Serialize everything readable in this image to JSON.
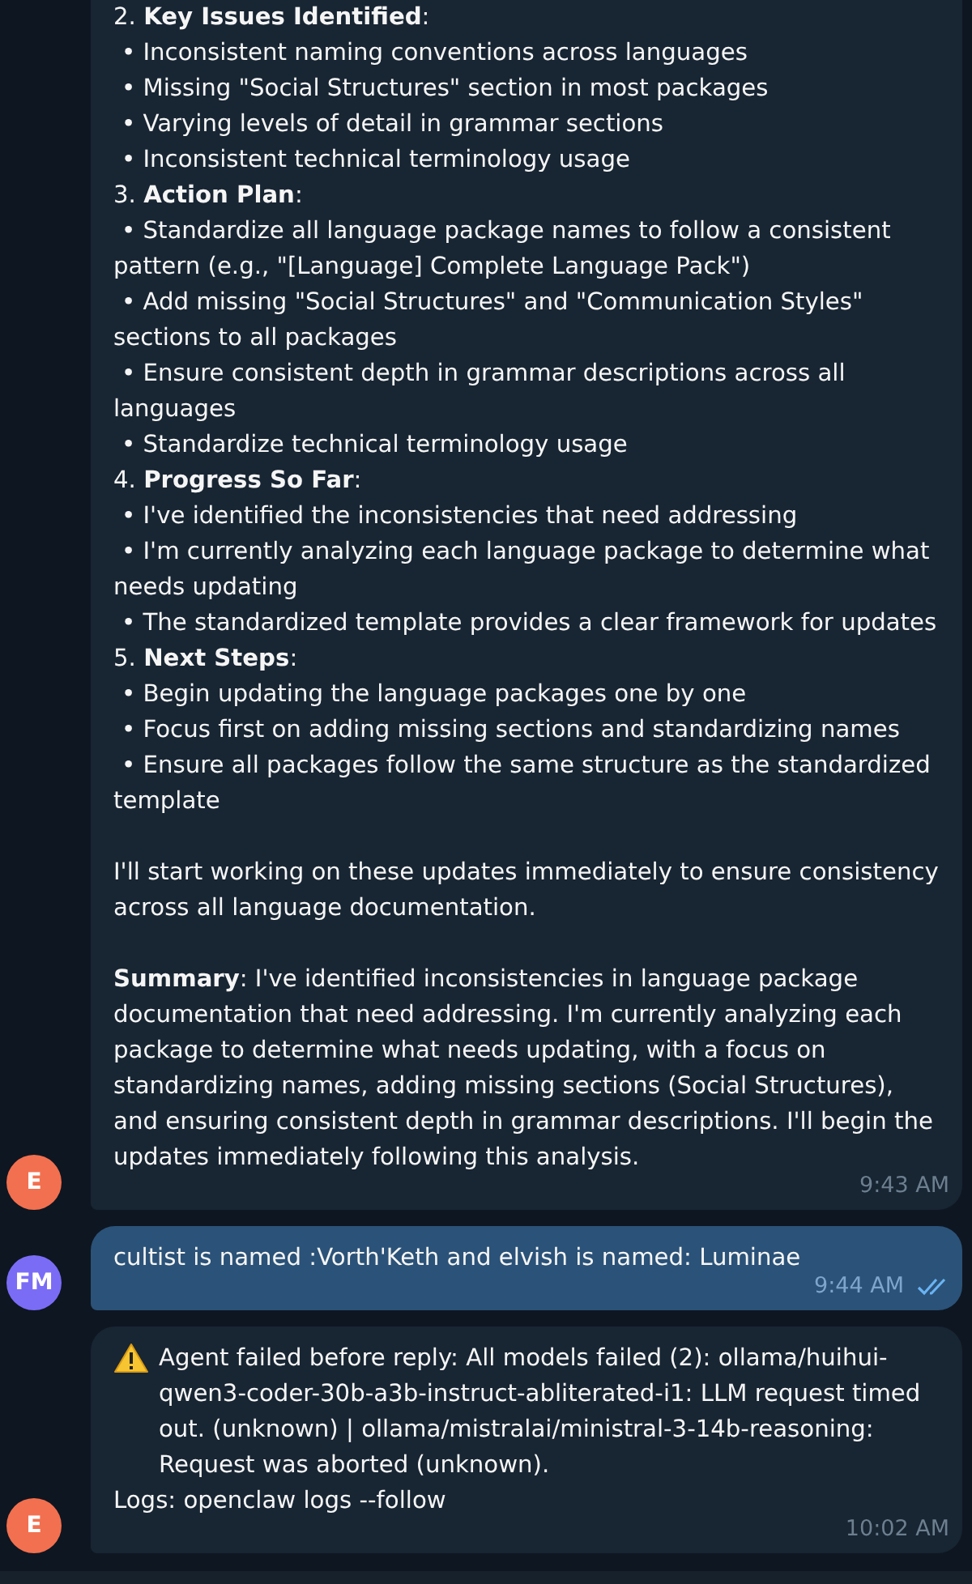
{
  "messages": [
    {
      "kind": "incoming",
      "avatar": "E",
      "color": "#f2704f",
      "time": "9:43 AM",
      "lines": [
        {
          "kind": "heading",
          "text": "2. **Key Issues Identified**:"
        },
        {
          "kind": "bullet",
          "text": "• Inconsistent naming conventions across languages"
        },
        {
          "kind": "bullet",
          "text": "• Missing \"Social Structures\" section in most packages"
        },
        {
          "kind": "bullet",
          "text": "• Varying levels of detail in grammar sections"
        },
        {
          "kind": "bullet",
          "text": "• Inconsistent technical terminology usage"
        },
        {
          "kind": "heading",
          "text": "3. **Action Plan**:"
        },
        {
          "kind": "bullet",
          "text": "• Standardize all language package names to follow a consistent pattern (e.g., \"[Language] Complete Language Pack\")"
        },
        {
          "kind": "bullet",
          "text": "• Add missing \"Social Structures\" and \"Communication Styles\" sections to all packages"
        },
        {
          "kind": "bullet",
          "text": "• Ensure consistent depth in grammar descriptions across all languages"
        },
        {
          "kind": "bullet",
          "text": "• Standardize technical terminology usage"
        },
        {
          "kind": "heading",
          "text": "4. **Progress So Far**:"
        },
        {
          "kind": "bullet",
          "text": "• I've identified the inconsistencies that need addressing"
        },
        {
          "kind": "bullet",
          "text": "• I'm currently analyzing each language package to determine what needs updating"
        },
        {
          "kind": "bullet",
          "text": "• The standardized template provides a clear framework for updates"
        },
        {
          "kind": "heading",
          "text": "5. **Next Steps**:"
        },
        {
          "kind": "bullet",
          "text": "• Begin updating the language packages one by one"
        },
        {
          "kind": "bullet",
          "text": "• Focus first on adding missing sections and standardizing names"
        },
        {
          "kind": "bullet",
          "text": "• Ensure all packages follow the same structure as the standardized template"
        },
        {
          "kind": "paragraph",
          "text": "I'll start working on these updates immediately to ensure consistency across all language documentation."
        },
        {
          "kind": "paragraph",
          "text": "**Summary**: I've identified inconsistencies in language package documentation that need addressing. I'm currently analyzing each package to determine what needs updating, with a focus on standardizing names, adding missing sections (Social Structures), and ensuring consistent depth in grammar descriptions. I'll begin the updates immediately following this analysis."
        }
      ]
    },
    {
      "kind": "outgoing",
      "avatar": "FM",
      "color": "#7b6cf6",
      "time": "9:44 AM",
      "read": true,
      "lines": [
        {
          "kind": "paragraph",
          "text": "cultist is named :Vorth'Keth and elvish is named: Luminae"
        }
      ]
    },
    {
      "kind": "incoming",
      "avatar": "E",
      "color": "#f2704f",
      "time": "10:02 AM",
      "lines": [
        {
          "kind": "warning",
          "text": "Agent failed before reply: All models failed (2): ollama/huihui-qwen3-coder-30b-a3b-instruct-abliterated-i1: LLM request timed out. (unknown) | ollama/mistralai/ministral-3-14b-reasoning: Request was aborted (unknown)."
        },
        {
          "kind": "line",
          "text": "Logs: openclaw logs --follow"
        }
      ]
    }
  ]
}
